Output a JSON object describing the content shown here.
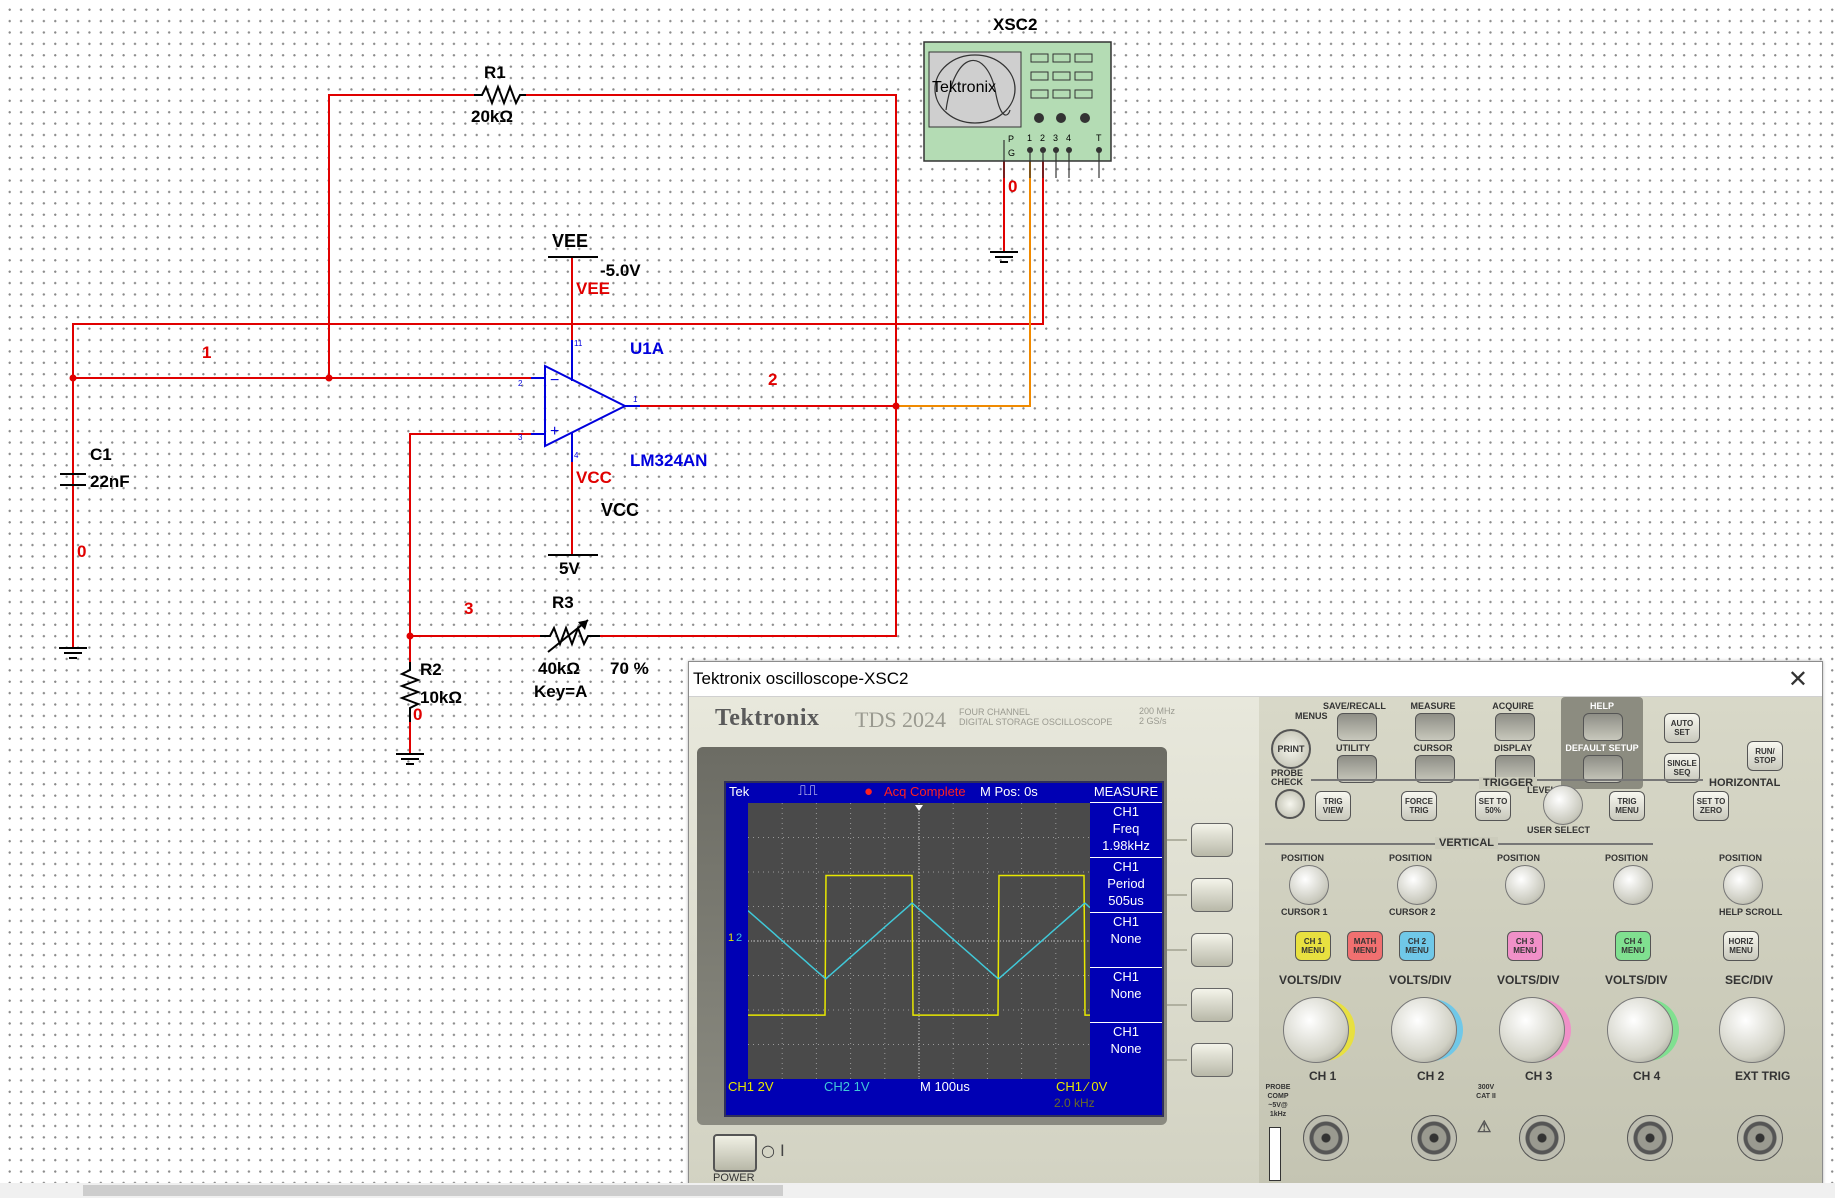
{
  "colors": {
    "wire_red": "#e00000",
    "wire_orange": "#f08a00",
    "component_blue": "#0000dd",
    "label_black": "#000000",
    "scope_screen": "#0000b4",
    "trace_ch1": "#e8e800",
    "trace_ch2": "#40c8d8"
  },
  "schematic": {
    "oscilloscope_ref": "XSC2",
    "scope_icon_brand": "Tektronix",
    "scope_icon_pins": {
      "p": "P",
      "g": "G",
      "ch1": "1",
      "ch2": "2",
      "ch3": "3",
      "ch4": "4",
      "trig": "T"
    },
    "scope_ground_label": "0",
    "r1": {
      "ref": "R1",
      "value": "20kΩ"
    },
    "vee": {
      "name": "VEE",
      "voltage": "-5.0V",
      "net": "VEE"
    },
    "opamp": {
      "ref": "U1A",
      "part": "LM324AN",
      "pin_minus": "2",
      "pin_plus": "3",
      "pin_out": "1",
      "pin_v_minus": "11",
      "pin_v_plus": "4",
      "minus_sign": "−",
      "plus_sign": "+"
    },
    "net_1": "1",
    "net_2": "2",
    "net_3": "3",
    "c1": {
      "ref": "C1",
      "value": "22nF"
    },
    "c1_ground_net": "0",
    "vcc": {
      "name": "VCC",
      "voltage": "5V",
      "net": "VCC"
    },
    "r3": {
      "ref": "R3",
      "value": "40kΩ",
      "key": "Key=A",
      "percent": "70 %"
    },
    "r2": {
      "ref": "R2",
      "value": "10kΩ",
      "ground_net": "0"
    }
  },
  "scope_window": {
    "title": "Tektronix oscilloscope-XSC2",
    "brand": "Tektronix",
    "model": "TDS 2024",
    "model_sub_1": "FOUR CHANNEL",
    "model_sub_2": "DIGITAL STORAGE OSCILLOSCOPE",
    "bandwidth_1": "200 MHz",
    "bandwidth_2": "2 GS/s",
    "screen": {
      "tek": "Tek",
      "status": "Acq Complete",
      "mpos": "M Pos: 0s",
      "measure_title": "MEASURE",
      "measurements": [
        {
          "ch": "CH1",
          "type": "Freq",
          "value": "1.98kHz"
        },
        {
          "ch": "CH1",
          "type": "Period",
          "value": "505us"
        },
        {
          "ch": "CH1",
          "type": "None",
          "value": ""
        },
        {
          "ch": "CH1",
          "type": "None",
          "value": ""
        },
        {
          "ch": "CH1",
          "type": "None",
          "value": ""
        }
      ],
      "ch1_scale": "CH1  2V",
      "ch2_scale": "CH2  1V",
      "time_scale": "M 100us",
      "trigger": "CH1 ⁄ 0V",
      "trigger_freq": "2.0 kHz",
      "ch1_marker": "1",
      "ch2_marker": "2"
    },
    "power_label": "POWER",
    "menus_label": "MENUS",
    "print_label": "PRINT",
    "probe_check_label": "PROBE CHECK",
    "top_labels": [
      "SAVE/RECALL",
      "MEASURE",
      "ACQUIRE",
      "HELP"
    ],
    "mid_labels": [
      "UTILITY",
      "CURSOR",
      "DISPLAY",
      "DEFAULT SETUP"
    ],
    "auto_set": "AUTO SET",
    "single_seq": "SINGLE SEQ",
    "run_stop": "RUN/ STOP",
    "trigger_title": "TRIGGER",
    "horizontal_title": "HORIZONTAL",
    "vertical_title": "VERTICAL",
    "level_label": "LEVEL",
    "user_select": "USER SELECT",
    "trig_view": "TRIG VIEW",
    "force_trig": "FORCE TRIG",
    "set_to_50": "SET TO 50%",
    "trig_menu": "TRIG MENU",
    "set_to_zero": "SET TO ZERO",
    "position_label": "POSITION",
    "cursor1": "CURSOR 1",
    "cursor2": "CURSOR 2",
    "help_scroll": "HELP SCROLL",
    "ch_menus": [
      "CH 1 MENU",
      "MATH MENU",
      "CH 2 MENU",
      "CH 3 MENU",
      "CH 4 MENU",
      "HORIZ MENU"
    ],
    "volts_div": "VOLTS/DIV",
    "sec_div": "SEC/DIV",
    "inputs": [
      "CH 1",
      "CH 2",
      "CH 3",
      "CH 4",
      "EXT TRIG"
    ],
    "probe_comp": "PROBE COMP ~5V@ 1kHz",
    "cat_label": "300V CAT II"
  }
}
